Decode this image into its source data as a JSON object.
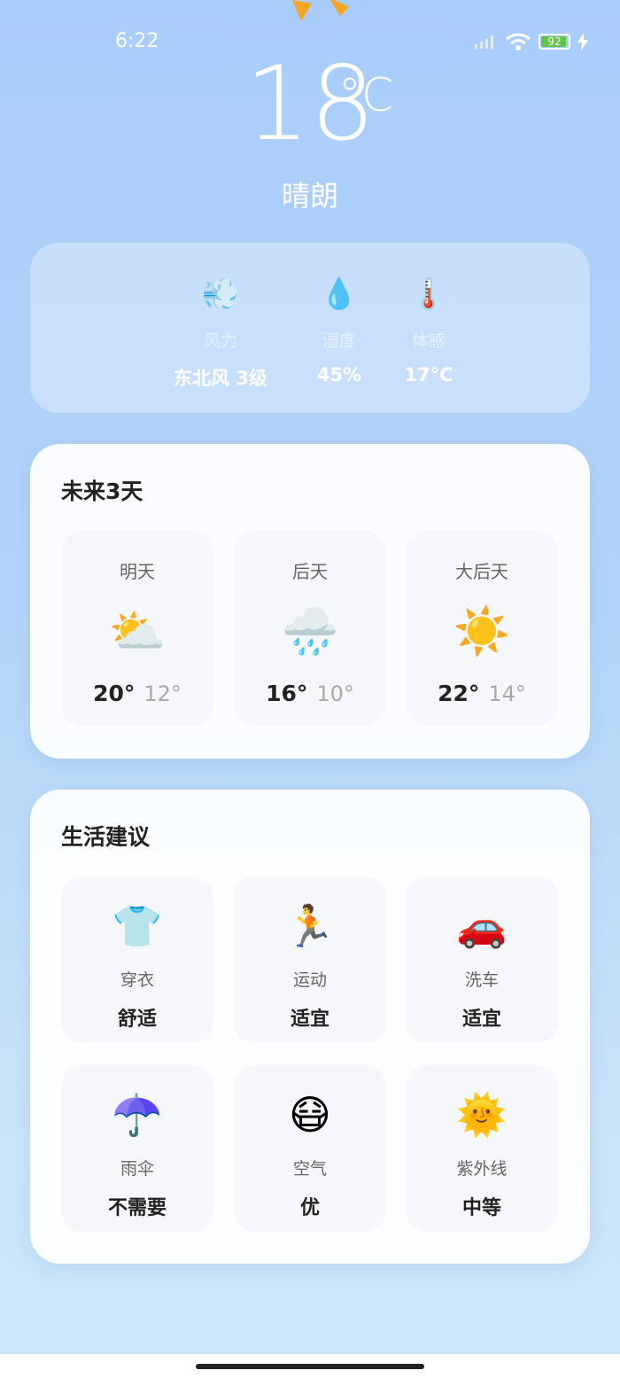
{
  "status": {
    "time": "6:22",
    "battery": "92"
  },
  "current": {
    "temperature": "18",
    "unit": "°C",
    "condition": "晴朗"
  },
  "details": [
    {
      "icon": "wind-icon",
      "glyph": "💨",
      "label": "风力",
      "value": "东北风 3级"
    },
    {
      "icon": "droplet-icon",
      "glyph": "💧",
      "label": "湿度",
      "value": "45%"
    },
    {
      "icon": "thermometer-icon",
      "glyph": "🌡️",
      "label": "体感",
      "value": "17°C"
    }
  ],
  "forecast": {
    "title": "未来3天",
    "days": [
      {
        "day": "明天",
        "icon": "sun-behind-cloud-icon",
        "glyph": "⛅",
        "high": "20°",
        "low": "12°"
      },
      {
        "day": "后天",
        "icon": "rain-cloud-icon",
        "glyph": "🌧️",
        "high": "16°",
        "low": "10°"
      },
      {
        "day": "大后天",
        "icon": "sun-icon",
        "glyph": "☀️",
        "high": "22°",
        "low": "14°"
      }
    ]
  },
  "life": {
    "title": "生活建议",
    "items": [
      {
        "icon": "tshirt-icon",
        "glyph": "👕",
        "label": "穿衣",
        "value": "舒适"
      },
      {
        "icon": "running-icon",
        "glyph": "🏃",
        "label": "运动",
        "value": "适宜"
      },
      {
        "icon": "car-icon",
        "glyph": "🚗",
        "label": "洗车",
        "value": "适宜"
      },
      {
        "icon": "umbrella-icon",
        "glyph": "☂️",
        "label": "雨伞",
        "value": "不需要"
      },
      {
        "icon": "mask-face-icon",
        "glyph": "😷",
        "label": "空气",
        "value": "优"
      },
      {
        "icon": "sun-face-icon",
        "glyph": "🌞",
        "label": "紫外线",
        "value": "中等"
      }
    ]
  }
}
